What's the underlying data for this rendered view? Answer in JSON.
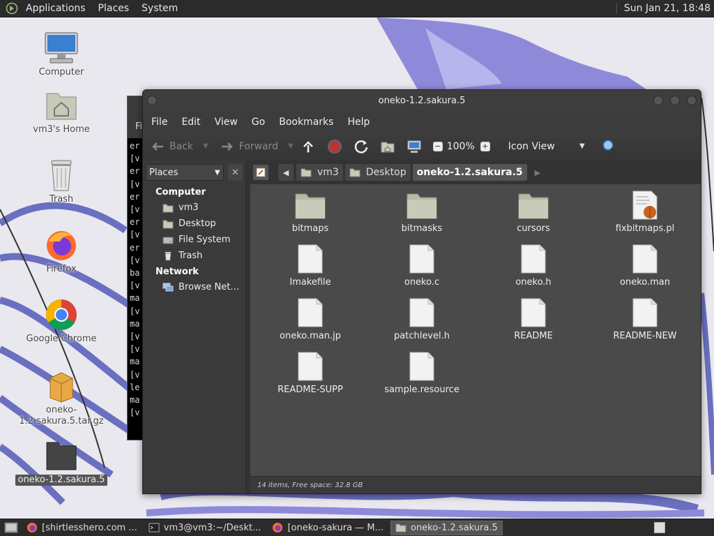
{
  "top_panel": {
    "menus": [
      "Applications",
      "Places",
      "System"
    ],
    "clock": "Sun Jan 21, 18:48"
  },
  "desktop": {
    "icons": [
      {
        "label": "Computer"
      },
      {
        "label": "vm3's Home"
      },
      {
        "label": "Trash"
      },
      {
        "label": "Firefox"
      },
      {
        "label": "Google Chrome"
      },
      {
        "label": "oneko-1.2.sakura.5.tar.gz"
      },
      {
        "label": "oneko-1.2.sakura.5"
      }
    ]
  },
  "terminal": {
    "title_fragment": "Fi",
    "lines": [
      "er",
      "[v",
      "er",
      "[v",
      "er",
      "[v",
      "er",
      "[v",
      "er",
      "[v",
      "ba",
      "[v",
      "ma",
      "[v",
      "ma",
      "[v",
      "[v",
      "ma",
      "[v",
      "le",
      "ma",
      "[v"
    ]
  },
  "file_manager": {
    "title": "oneko-1.2.sakura.5",
    "menus": [
      "File",
      "Edit",
      "View",
      "Go",
      "Bookmarks",
      "Help"
    ],
    "toolbar": {
      "back": "Back",
      "forward": "Forward",
      "zoom": "100%",
      "view_mode": "Icon View"
    },
    "sidebar": {
      "selector": "Places",
      "groups": [
        {
          "title": "Computer",
          "items": [
            "vm3",
            "Desktop",
            "File System",
            "Trash"
          ]
        },
        {
          "title": "Network",
          "items": [
            "Browse Net…"
          ]
        }
      ]
    },
    "breadcrumbs": [
      "vm3",
      "Desktop",
      "oneko-1.2.sakura.5"
    ],
    "files": [
      {
        "name": "bitmaps",
        "kind": "folder"
      },
      {
        "name": "bitmasks",
        "kind": "folder"
      },
      {
        "name": "cursors",
        "kind": "folder"
      },
      {
        "name": "fixbitmaps.pl",
        "kind": "script"
      },
      {
        "name": "Imakefile",
        "kind": "file"
      },
      {
        "name": "oneko.c",
        "kind": "file"
      },
      {
        "name": "oneko.h",
        "kind": "file"
      },
      {
        "name": "oneko.man",
        "kind": "file"
      },
      {
        "name": "oneko.man.jp",
        "kind": "file"
      },
      {
        "name": "patchlevel.h",
        "kind": "file"
      },
      {
        "name": "README",
        "kind": "file"
      },
      {
        "name": "README-NEW",
        "kind": "file"
      },
      {
        "name": "README-SUPP",
        "kind": "file"
      },
      {
        "name": "sample.resource",
        "kind": "file"
      }
    ],
    "status": "14 items, Free space: 32.8 GB"
  },
  "taskbar": {
    "tasks": [
      {
        "label": "[shirtlesshero.com ...",
        "icon": "firefox-icon"
      },
      {
        "label": "vm3@vm3:~/Deskt...",
        "icon": "terminal-icon"
      },
      {
        "label": "[oneko-sakura — M...",
        "icon": "firefox-icon"
      },
      {
        "label": "oneko-1.2.sakura.5",
        "icon": "folder-icon"
      }
    ]
  },
  "colors": {
    "panel": "#2b2b2b",
    "window": "#3c3c3c",
    "content": "#4a4a4a",
    "wallpaper_accent": "#8a86d8"
  }
}
